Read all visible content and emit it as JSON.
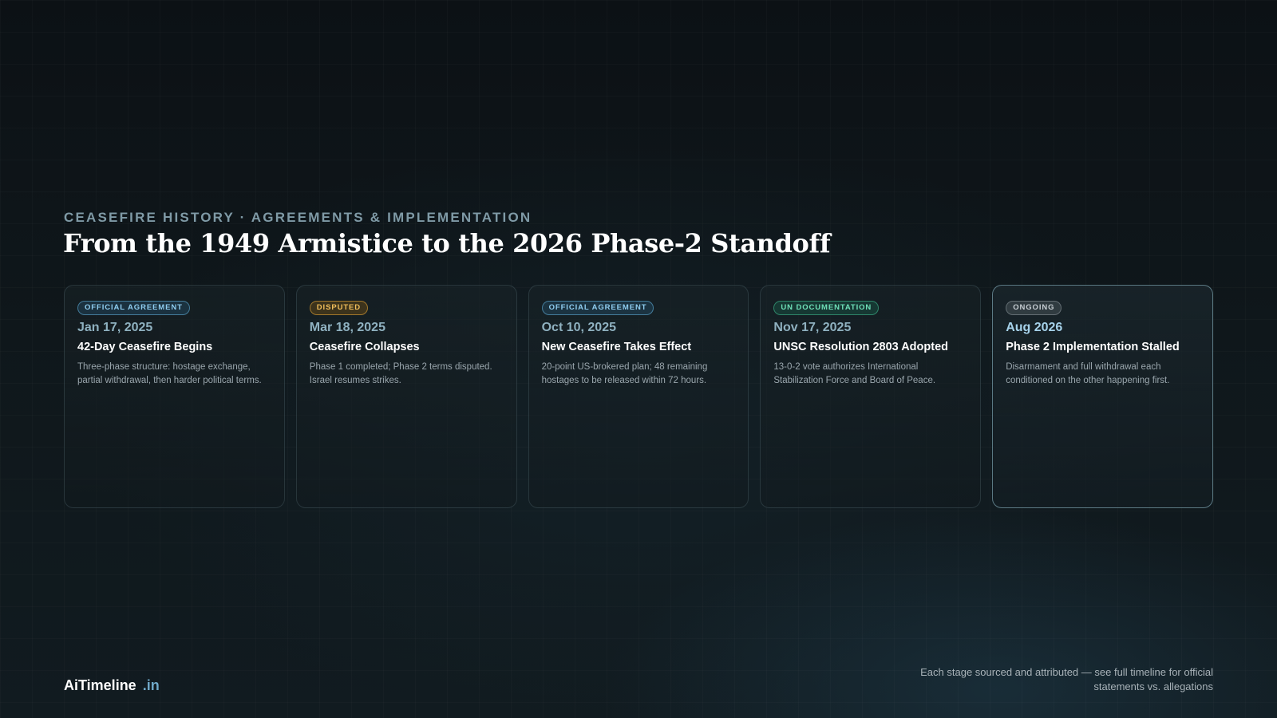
{
  "header": {
    "eyebrow": "CEASEFIRE HISTORY · AGREEMENTS & IMPLEMENTATION",
    "title": "From the 1949 Armistice to the 2026 Phase-2 Standoff"
  },
  "colors": {
    "official": "#8fcdf0",
    "disputed": "#f0be5a",
    "un_documentation": "#6fe0b8",
    "ongoing": "#c6cdd2",
    "brand_accent": "#6fa8c8"
  },
  "cards": [
    {
      "badge": "OFFICIAL AGREEMENT",
      "date": "Jan 17, 2025",
      "title": "42-Day Ceasefire Begins",
      "description": "Three-phase structure: hostage exchange, partial withdrawal, then harder political terms."
    },
    {
      "badge": "DISPUTED",
      "date": "Mar 18, 2025",
      "title": "Ceasefire Collapses",
      "description": "Phase 1 completed; Phase 2 terms disputed. Israel resumes strikes."
    },
    {
      "badge": "OFFICIAL AGREEMENT",
      "date": "Oct 10, 2025",
      "title": "New Ceasefire Takes Effect",
      "description": "20-point US-brokered plan; 48 remaining hostages to be released within 72 hours."
    },
    {
      "badge": "UN DOCUMENTATION",
      "date": "Nov 17, 2025",
      "title": "UNSC Resolution 2803 Adopted",
      "description": "13-0-2 vote authorizes International Stabilization Force and Board of Peace."
    },
    {
      "badge": "ONGOING",
      "date": "Aug 2026",
      "title": "Phase 2 Implementation Stalled",
      "description": "Disarmament and full withdrawal each conditioned on the other happening first."
    }
  ],
  "footer": {
    "brand_name": "AiTimeline",
    "brand_tld": ".in",
    "note": "Each stage sourced and attributed — see full timeline for official statements vs. allegations"
  }
}
